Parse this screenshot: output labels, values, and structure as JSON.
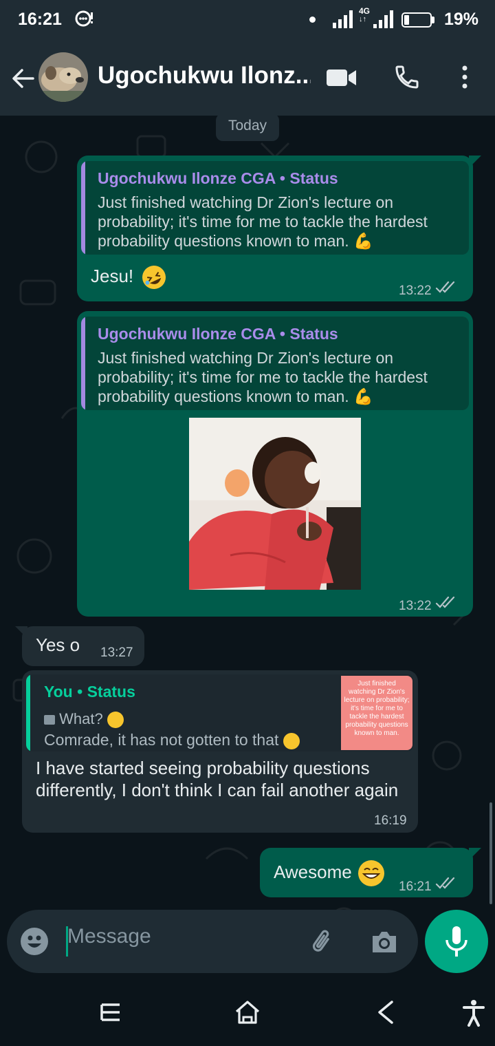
{
  "status_bar": {
    "time": "16:21",
    "network": "4G",
    "battery": "19%",
    "battery_level": 0.19
  },
  "header": {
    "contact_name": "Ugochukwu Ilonz..."
  },
  "chat": {
    "date_chip": "Today",
    "messages": [
      {
        "quote_title": "Ugochukwu Ilonze CGA • Status",
        "quote_text": "Just finished watching Dr Zion's lecture on probability; it's time for me to tackle the hardest probability questions known to man.",
        "text": "Jesu!",
        "time": "13:22"
      },
      {
        "quote_title": "Ugochukwu Ilonze CGA • Status",
        "quote_text": "Just finished watching Dr Zion's lecture on probability; it's time for me to tackle the hardest probability questions known to man.",
        "time": "13:22"
      },
      {
        "text": "Yes o",
        "time": "13:27"
      },
      {
        "quote_title": "You • Status",
        "quote_line1": "What?",
        "quote_line2": "Comrade, it has not gotten to that",
        "thumb_text": "Just finished watching Dr Zion's lecture on probability; it's time for me to tackle the hardest probability questions known to man.",
        "text": "I have started seeing probability questions differently, I don't think I can fail another again",
        "time": "16:19"
      },
      {
        "text": "Awesome",
        "time": "16:21"
      }
    ]
  },
  "input": {
    "placeholder": "Message"
  },
  "colors": {
    "outgoing_bubble": "#005c4b",
    "incoming_bubble": "#202c33",
    "accent": "#00a884",
    "quote_author": "#a98cea",
    "read_ticks": "#b7c4ca"
  }
}
